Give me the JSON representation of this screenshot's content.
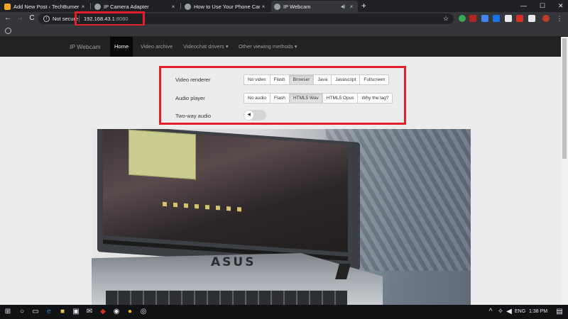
{
  "browser": {
    "tabs": [
      {
        "title": "Add New Post ‹ TechBurner — W",
        "favicon_color": "#f5a623",
        "active": false
      },
      {
        "title": "IP Camera Adapter",
        "favicon_color": "#9aa0a6",
        "active": false
      },
      {
        "title": "How to Use Your Phone Camera",
        "favicon_color": "#9aa0a6",
        "active": false
      },
      {
        "title": "IP Webcam",
        "favicon_color": "#9aa0a6",
        "active": true
      }
    ],
    "tab_close_glyph": "×",
    "audio_glyph": "◀)",
    "new_tab_glyph": "+",
    "window_controls": {
      "minimize": "—",
      "maximize": "☐",
      "close": "✕"
    },
    "toolbar": {
      "back": "←",
      "forward": "→",
      "reload": "C",
      "info": "i"
    },
    "address": {
      "security_label": "Not secure",
      "host": "192.168.43.1",
      "port": ":8080",
      "star_glyph": "☆"
    },
    "highlight_color": "#e0202a"
  },
  "navbar": {
    "brand": "IP Webcam",
    "items": [
      {
        "label": "Home",
        "active": true
      },
      {
        "label": "Video archive",
        "active": false
      },
      {
        "label": "Videochat drivers ▾",
        "active": false
      },
      {
        "label": "Other viewing methods ▾",
        "active": false
      }
    ]
  },
  "controls": {
    "video_renderer": {
      "label": "Video renderer",
      "options": [
        "No video",
        "Flash",
        "Browser",
        "Java",
        "Javascript",
        "Fullscreen"
      ],
      "selected": "Browser"
    },
    "audio_player": {
      "label": "Audio player",
      "options": [
        "No audio",
        "Flash",
        "HTML5 Wav",
        "HTML5 Opus",
        "Why the lag?"
      ],
      "selected": "HTML5 Wav"
    },
    "two_way_audio": {
      "label": "Two-way audio",
      "enabled": false,
      "icon": "megaphone-icon"
    }
  },
  "feed": {
    "laptop_brand": "ASUS"
  },
  "taskbar": {
    "language": "ENG",
    "time": "1:38 PM",
    "start_glyph": "⊞",
    "search_glyph": "○"
  }
}
